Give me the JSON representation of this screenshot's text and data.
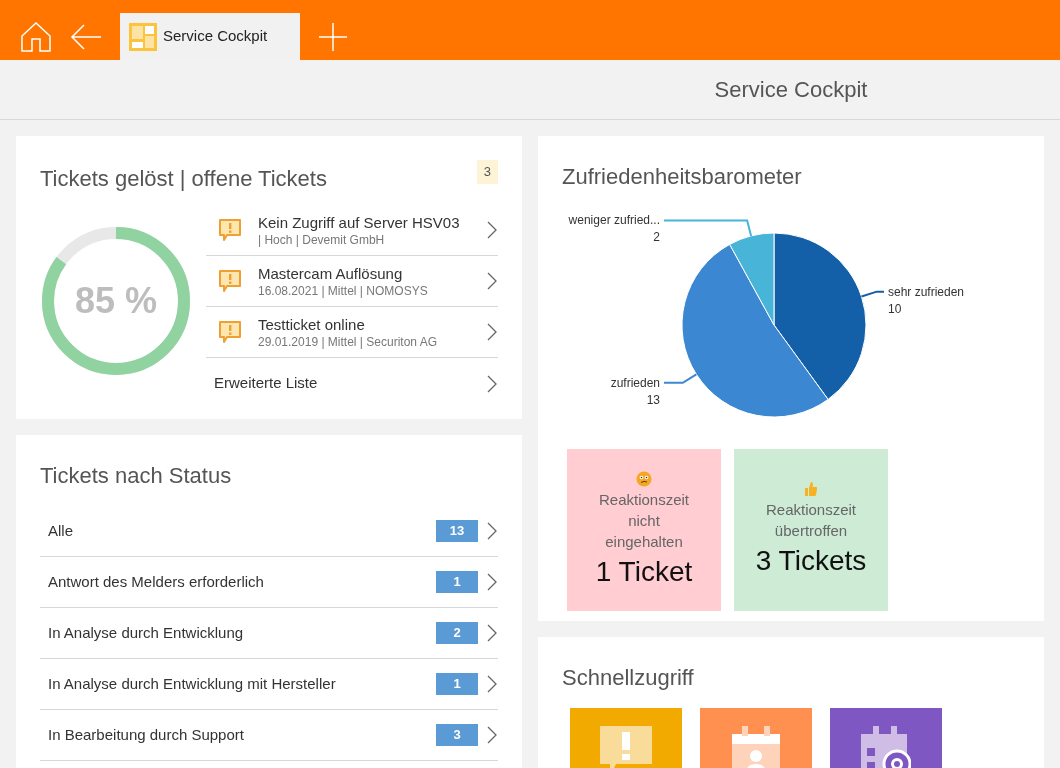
{
  "top_bar": {
    "tabs": [
      {
        "label": "Service Cockpit",
        "selected": true
      }
    ]
  },
  "page_title": "Service Cockpit",
  "tickets_card": {
    "title": "Tickets gelöst | offene Tickets",
    "count": "3",
    "ring": {
      "level": 0.85,
      "label": "85 %"
    },
    "tickets": [
      {
        "title": "Kein Zugriff auf Server HSV03",
        "meta": "| Hoch | Devemit GmbH"
      },
      {
        "title": "Mastercam Auflösung",
        "meta": "16.08.2021 | Mittel | NOMOSYS"
      },
      {
        "title": "Testticket online",
        "meta": "29.01.2019 | Mittel | Securiton AG"
      }
    ],
    "more_link": "Erweiterte Liste"
  },
  "status_card": {
    "title": "Tickets nach Status",
    "rows": [
      {
        "label": "Alle",
        "count": "13"
      },
      {
        "label": "Antwort des Melders erforderlich",
        "count": "1"
      },
      {
        "label": "In Analyse durch Entwicklung",
        "count": "2"
      },
      {
        "label": "In Analyse durch Entwicklung mit Hersteller",
        "count": "1"
      },
      {
        "label": "In Bearbeitung durch Support",
        "count": "3"
      }
    ]
  },
  "satisfaction_card": {
    "title": "Zufriedenheitsbarometer",
    "chart_data": {
      "type": "pie",
      "categories": [
        "sehr zufrieden",
        "zufrieden",
        "weniger zufried..."
      ],
      "series": [
        {
          "colors": [
            "#135fa8",
            "#3b87d1",
            "#48b4d8"
          ],
          "values": [
            10,
            13,
            2
          ]
        }
      ],
      "data_labels": true
    },
    "tiles": [
      {
        "kind": "missed",
        "text": "Reaktionszeit nicht eingehalten",
        "value": "1 Ticket"
      },
      {
        "kind": "exceeded",
        "text": "Reaktionszeit übertroffen",
        "value": "3 Tickets"
      }
    ]
  },
  "quick_access": {
    "title": "Schnellzugriff",
    "tiles": [
      {
        "kind": "ticket",
        "color": "#f2a900"
      },
      {
        "kind": "contact",
        "color": "#ff9050"
      },
      {
        "kind": "schedule",
        "color": "#7e57c2"
      }
    ]
  }
}
